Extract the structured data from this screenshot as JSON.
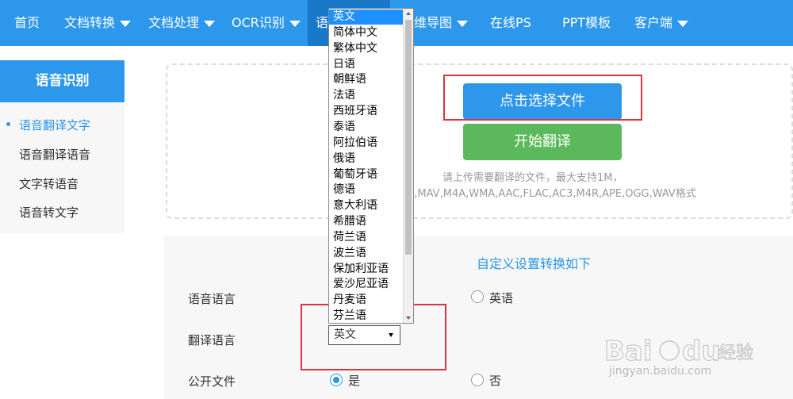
{
  "nav": {
    "items": [
      {
        "label": "首页",
        "has_caret": false
      },
      {
        "label": "文档转换",
        "has_caret": true
      },
      {
        "label": "文档处理",
        "has_caret": true
      },
      {
        "label": "OCR识别",
        "has_caret": true
      },
      {
        "label": "语",
        "has_caret": false
      },
      {
        "label": "维导图",
        "has_caret": true
      },
      {
        "label": "在线PS",
        "has_caret": false
      },
      {
        "label": "PPT模板",
        "has_caret": false
      },
      {
        "label": "客户端",
        "has_caret": true
      }
    ]
  },
  "sidebar": {
    "title": "语音识别",
    "items": [
      {
        "label": "语音翻译文字",
        "active": true
      },
      {
        "label": "语音翻译语音",
        "active": false
      },
      {
        "label": "文字转语音",
        "active": false
      },
      {
        "label": "语音转文字",
        "active": false
      }
    ]
  },
  "upload": {
    "choose_file_label": "点击选择文件",
    "start_label": "开始翻译",
    "tip_line1": "请上传需要翻译的文件，最大支持1M，",
    "tip_line2": "3,MAV,M4A,WMA,AAC,FLAC,AC3,M4R,APE,OGG,WAV格式"
  },
  "settings": {
    "title": "自定义设置转换如下",
    "speech_language_label": "语音语言",
    "speech_language_option": "英语",
    "translate_language_label": "翻译语言",
    "translate_language_value": "英文",
    "public_file_label": "公开文件",
    "public_yes": "是",
    "public_no": "否"
  },
  "dropdown": {
    "options": [
      "英文",
      "简体中文",
      "繁体中文",
      "日语",
      "朝鲜语",
      "法语",
      "西班牙语",
      "泰语",
      "阿拉伯语",
      "俄语",
      "葡萄牙语",
      "德语",
      "意大利语",
      "希腊语",
      "荷兰语",
      "波兰语",
      "保加利亚语",
      "爱沙尼亚语",
      "丹麦语",
      "芬兰语"
    ],
    "selected_index": 0
  },
  "watermark": {
    "logo_text": "Bai du 经验",
    "url_text": "jingyan.baidu.com"
  },
  "colors": {
    "accent": "#2c97eb",
    "green": "#5cb85c",
    "annotation_red": "#d9343f"
  }
}
